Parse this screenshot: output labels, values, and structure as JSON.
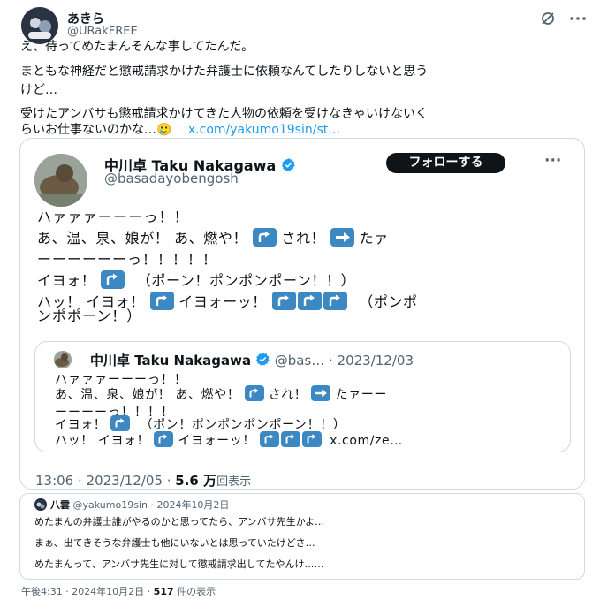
{
  "author": {
    "name": "あきら",
    "handle": "@URakFREE"
  },
  "tweet_lines": [
    "え、待ってめたまんそんな事してたんだ。",
    "まともな神経だと懲戒請求かけた弁護士に依頼なんてしたりしないと思う",
    "けど…",
    "受けたアンバサも懲戒請求かけてきた人物の依頼を受けなきゃいけないく",
    "らいお仕事ないのかな…"
  ],
  "tweet_emoji": "🥲",
  "tweet_link": "x.com/yakumo19sin/st…",
  "quoted": {
    "name": "中川卓 Taku Nakagawa",
    "handle": "@basadayobengosh",
    "follow_label": "フォローする",
    "more_label": "···",
    "lines": {
      "l1": "ハァァァーーーっ！！",
      "l2a": "あ、温、泉、娘が！ あ、燃や！",
      "l2b": "され！",
      "l2c": "たァ",
      "l3": "ーーーーーーっ！！！！！",
      "l4a": "イヨォ！",
      "l4b": "（ポーン！ポンポンポーン！！）",
      "l5a": "ハッ！ イヨォ！",
      "l5b": "イヨォーッ！",
      "l5c": "（ポンポ",
      "l6": "ンポポーン！）"
    },
    "inner": {
      "name": "中川卓 Taku Nakagawa",
      "handle_date": "@bas… · 2023/12/03",
      "lines": {
        "l1": "ハァァァーーーっ！！",
        "l2a": "あ、温、泉、娘が！ あ、燃や！",
        "l2b": "され！",
        "l2c": "たァーー",
        "l3": "ーーーーっ！！！！",
        "l4a": "イヨォ！",
        "l4b": "（ポン！ポンポンポンポーン！！）",
        "l5a": "ハッ！ イヨォ！",
        "l5b": "イヨォーッ！",
        "l5c": "x.com/ze…"
      }
    },
    "time_date": "13:06 · 2023/12/05 · ",
    "views_count": "5.6 万",
    "views_label": "回表示"
  },
  "reply_card": {
    "name": "八雲",
    "handle_date": "@yakumo19sin · 2024年10月2日",
    "lines": [
      "めたまんの弁護士誰がやるのかと思ってたら、アンバサ先生かよ…",
      "まぁ、出てきそうな弁護士も他にいないとは思っていたけどさ…",
      "めたまんって、アンバサ先生に対して懲戒請求出してたやんけ……"
    ]
  },
  "footer": {
    "time_date": "午後4:31 · 2024年10月2日 · ",
    "views_count": "517",
    "views_label": " 件の表示"
  },
  "colors": {
    "accent": "#1d9bf0",
    "text": "#0f1419",
    "muted": "#536471",
    "keycap": "#3b88c3",
    "border": "#cfd9de"
  },
  "icons": [
    "grok-icon",
    "more-icon",
    "verified-badge-icon",
    "up-arrow-keycap-icon",
    "right-arrow-keycap-icon"
  ]
}
